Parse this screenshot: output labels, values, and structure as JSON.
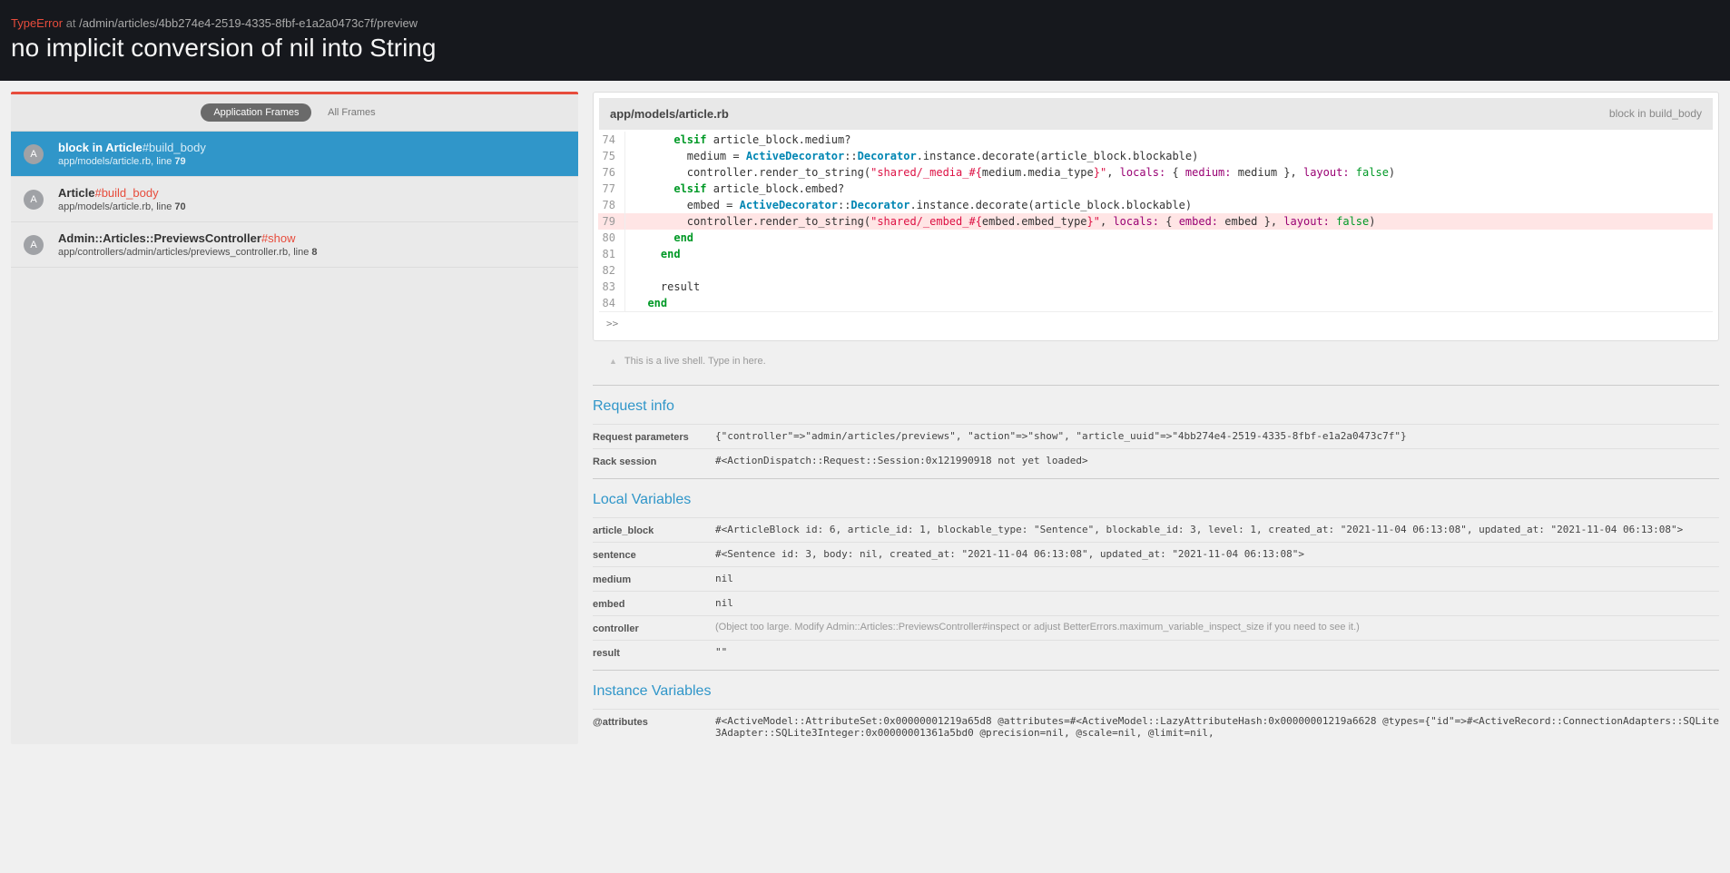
{
  "header": {
    "error_type": "TypeError",
    "at": " at ",
    "path": "/admin/articles/4bb274e4-2519-4335-8fbf-e1a2a0473c7f/preview",
    "message": "no implicit conversion of nil into String"
  },
  "tabs": {
    "app": "Application Frames",
    "all": "All Frames"
  },
  "frames": [
    {
      "icon": "A",
      "title_pre": "block in Article",
      "title_method": "#build_body",
      "loc_pre": "app/models/article.rb, line ",
      "loc_line": "79"
    },
    {
      "icon": "A",
      "title_pre": "Article",
      "title_method": "#build_body",
      "loc_pre": "app/models/article.rb, line ",
      "loc_line": "70"
    },
    {
      "icon": "A",
      "title_pre": "Admin::Articles::PreviewsController",
      "title_method": "#show",
      "loc_pre": "app/controllers/admin/articles/previews_controller.rb, line ",
      "loc_line": "8"
    }
  ],
  "code": {
    "file": "app/models/article.rb",
    "location": "block in build_body",
    "prompt": ">>"
  },
  "shell_hint": "This is a live shell. Type in here.",
  "sections": {
    "request": {
      "title": "Request info",
      "rows": [
        {
          "k": "Request parameters",
          "v": "{\"controller\"=>\"admin/articles/previews\", \"action\"=>\"show\", \"article_uuid\"=>\"4bb274e4-2519-4335-8fbf-e1a2a0473c7f\"}"
        },
        {
          "k": "Rack session",
          "v": "#<ActionDispatch::Request::Session:0x121990918 not yet loaded>"
        }
      ]
    },
    "locals": {
      "title": "Local Variables",
      "rows": [
        {
          "k": "article_block",
          "v": "#<ArticleBlock id: 6, article_id: 1, blockable_type: \"Sentence\", blockable_id: 3, level: 1, created_at: \"2021-11-04 06:13:08\", updated_at: \"2021-11-04 06:13:08\">"
        },
        {
          "k": "sentence",
          "v": "#<Sentence id: 3, body: nil, created_at: \"2021-11-04 06:13:08\", updated_at: \"2021-11-04 06:13:08\">"
        },
        {
          "k": "medium",
          "v": "nil"
        },
        {
          "k": "embed",
          "v": "nil"
        },
        {
          "k": "controller",
          "v": "(Object too large. Modify Admin::Articles::PreviewsController#inspect or adjust BetterErrors.maximum_variable_inspect_size if you need to see it.)",
          "dim": true
        },
        {
          "k": "result",
          "v": "\"\""
        }
      ]
    },
    "ivars": {
      "title": "Instance Variables",
      "rows": [
        {
          "k": "@attributes",
          "v": "#<ActiveModel::AttributeSet:0x00000001219a65d8 @attributes=#<ActiveModel::LazyAttributeHash:0x00000001219a6628 @types={\"id\"=>#<ActiveRecord::ConnectionAdapters::SQLite3Adapter::SQLite3Integer:0x00000001361a5bd0 @precision=nil, @scale=nil, @limit=nil,"
        }
      ]
    }
  }
}
